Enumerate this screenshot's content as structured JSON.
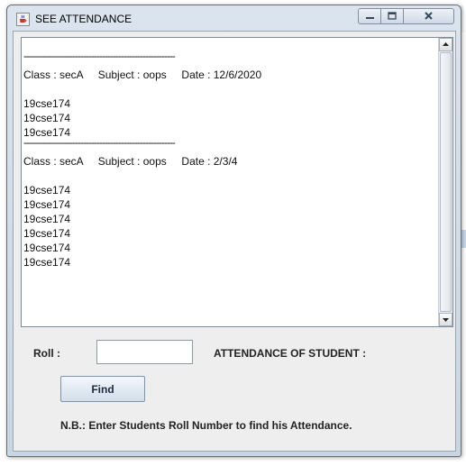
{
  "window": {
    "title": "SEE ATTENDANCE"
  },
  "output": {
    "lines": [
      "--------------------------------------------------------",
      "Class : secA     Subject : oops     Date : 12/6/2020",
      "",
      "19cse174",
      "19cse174",
      "19cse174",
      "--------------------------------------------------------",
      "Class : secA     Subject : oops     Date : 2/3/4",
      "",
      "19cse174",
      "19cse174",
      "19cse174",
      "19cse174",
      "19cse174",
      "19cse174"
    ]
  },
  "form": {
    "roll_label": "Roll :",
    "roll_value": "",
    "attendance_label": "ATTENDANCE OF STUDENT :",
    "find_label": "Find",
    "note": "N.B.:  Enter Students Roll Number to find his Attendance."
  },
  "icons": {
    "app": "java-cup-icon",
    "minimize": "minimize-icon",
    "maximize": "maximize-icon",
    "close": "close-icon",
    "scroll_up": "arrow-up-icon",
    "scroll_down": "arrow-down-icon"
  }
}
